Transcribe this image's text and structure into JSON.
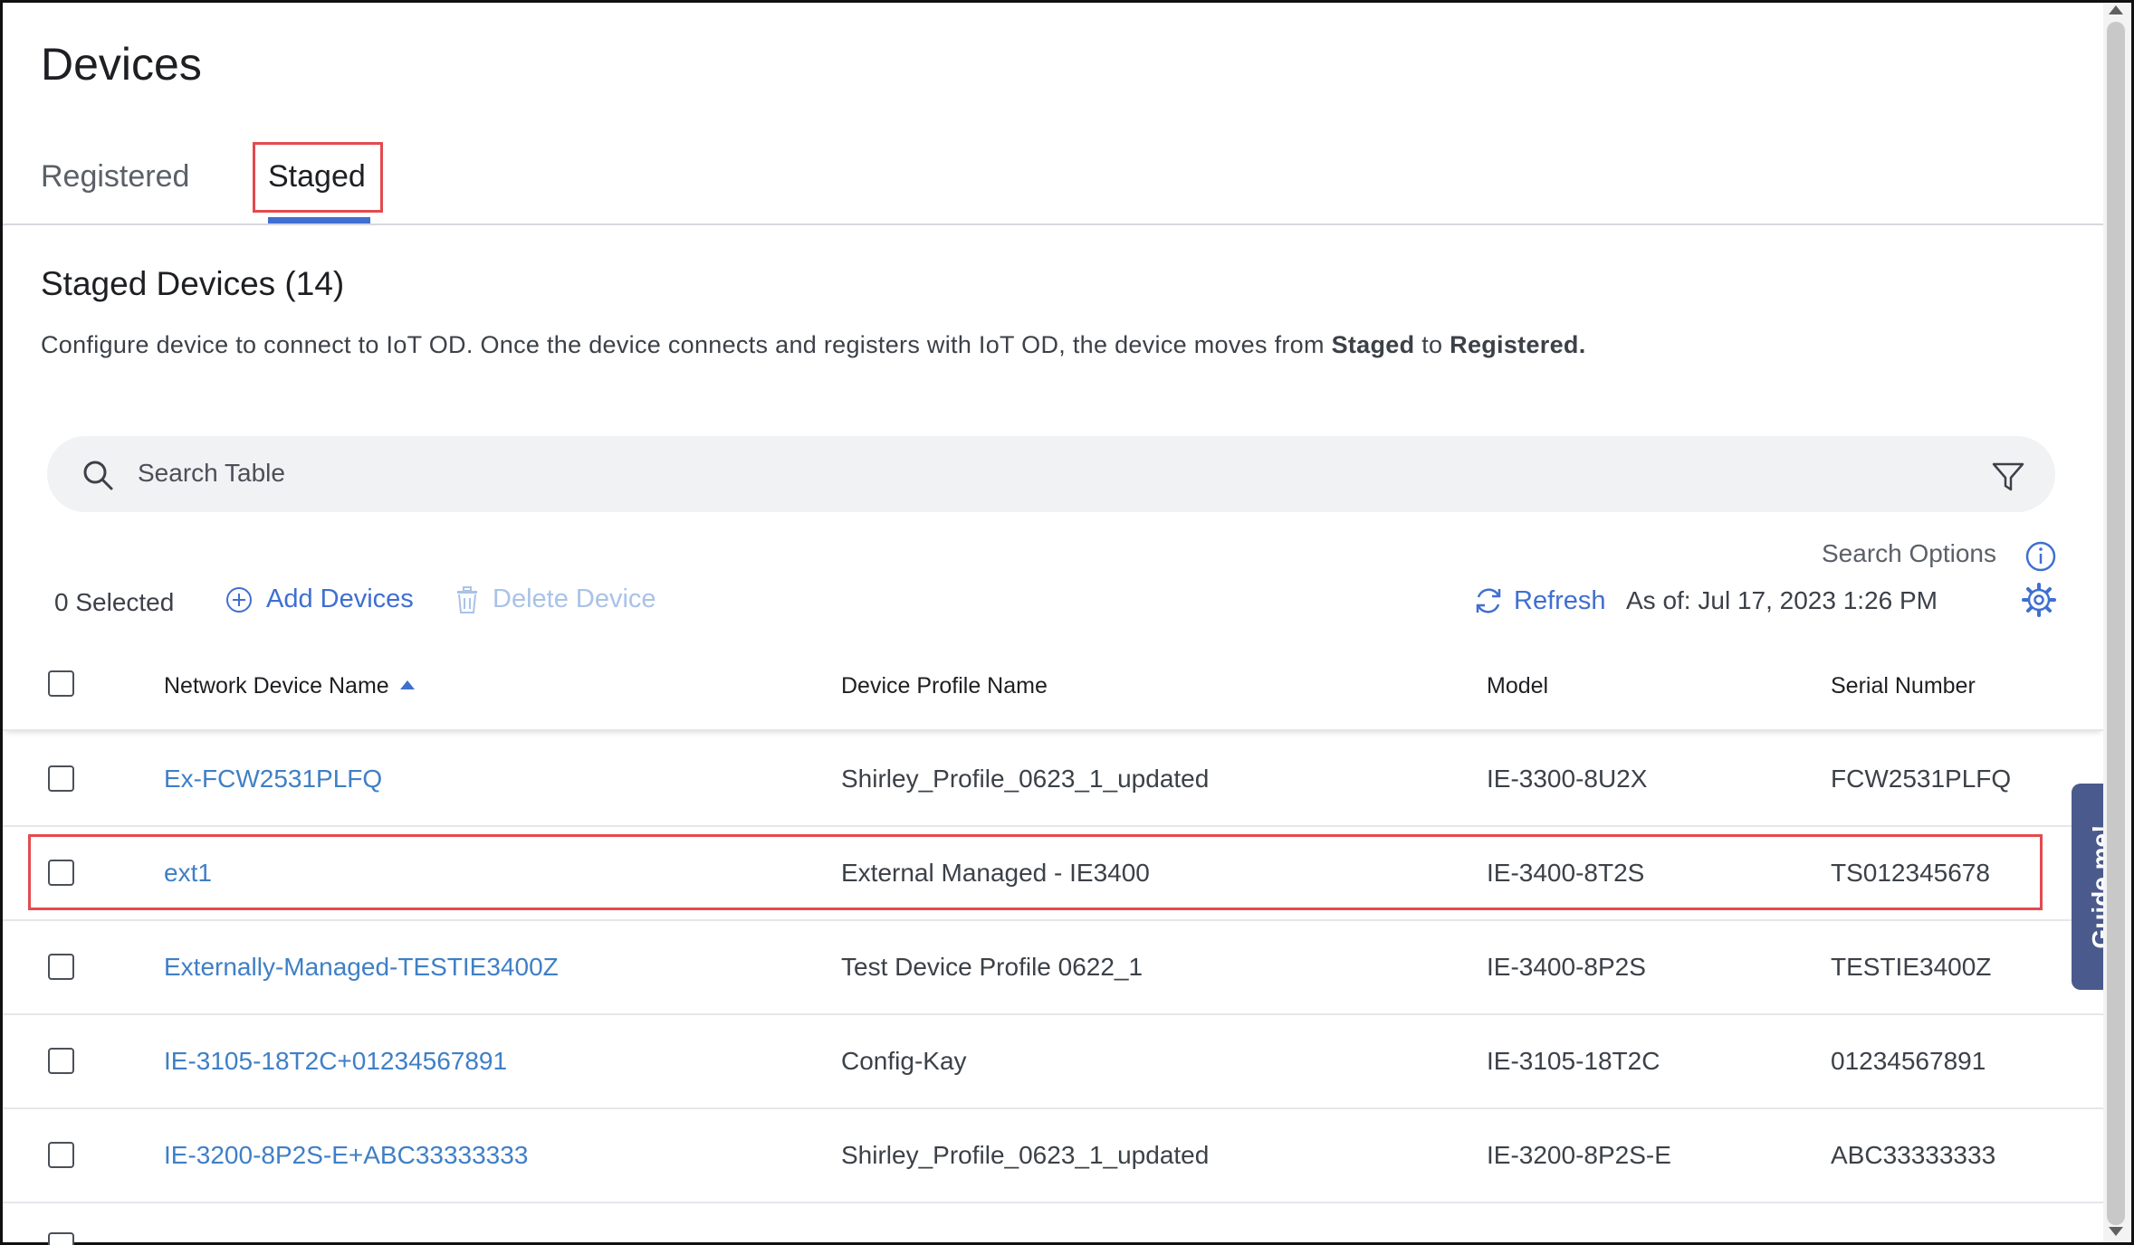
{
  "page": {
    "title": "Devices"
  },
  "tabs": [
    {
      "label": "Registered",
      "active": false
    },
    {
      "label": "Staged",
      "active": true
    }
  ],
  "section": {
    "title": "Staged Devices (14)",
    "description_pre": "Configure device to connect to IoT OD. Once the device connects and registers with IoT OD, the device moves from ",
    "description_b1": "Staged",
    "description_mid": " to ",
    "description_b2": "Registered."
  },
  "search": {
    "placeholder": "Search Table",
    "options_label": "Search Options"
  },
  "toolbar": {
    "selected": "0 Selected",
    "add_label": "Add Devices",
    "delete_label": "Delete Device",
    "refresh_label": "Refresh",
    "as_of": "As of: Jul 17, 2023 1:26 PM"
  },
  "table": {
    "headers": [
      "Network Device Name",
      "Device Profile Name",
      "Model",
      "Serial Number"
    ],
    "rows": [
      {
        "name": "Ex-FCW2531PLFQ",
        "profile": "Shirley_Profile_0623_1_updated",
        "model": "IE-3300-8U2X",
        "serial": "FCW2531PLFQ"
      },
      {
        "name": "ext1",
        "profile": "External Managed - IE3400",
        "model": "IE-3400-8T2S",
        "serial": "TS012345678"
      },
      {
        "name": "Externally-Managed-TESTIE3400Z",
        "profile": "Test Device Profile 0622_1",
        "model": "IE-3400-8P2S",
        "serial": "TESTIE3400Z"
      },
      {
        "name": "IE-3105-18T2C+01234567891",
        "profile": "Config-Kay",
        "model": "IE-3105-18T2C",
        "serial": "01234567891"
      },
      {
        "name": "IE-3200-8P2S-E+ABC33333333",
        "profile": "Shirley_Profile_0623_1_updated",
        "model": "IE-3200-8P2S-E",
        "serial": "ABC33333333"
      }
    ]
  },
  "guide": {
    "label": "Guide me!"
  },
  "colors": {
    "accent": "#3f6fd1",
    "link": "#3f7fc6",
    "highlight": "#e34a4f",
    "guide": "#4a5a8c"
  }
}
